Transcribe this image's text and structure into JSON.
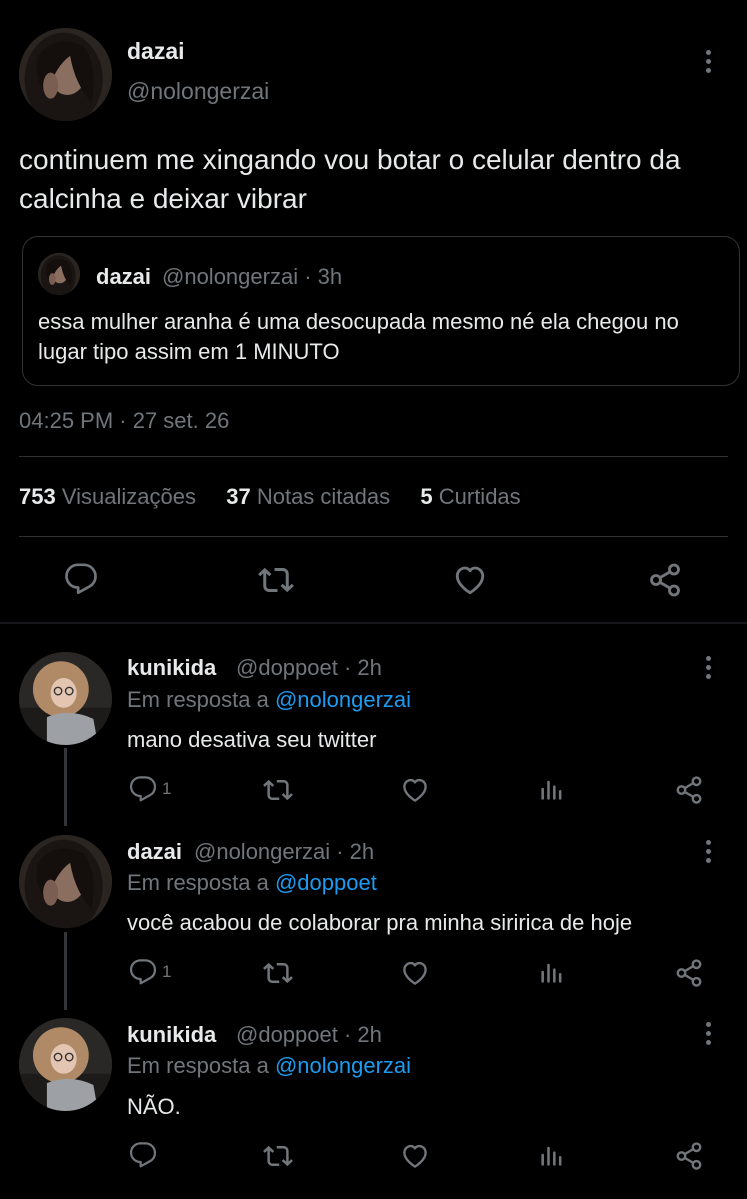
{
  "tweet": {
    "author_name": "dazai",
    "author_handle": "@nolongerzai",
    "text": "continuem me xingando vou botar o celular dentro da calcinha e deixar vibrar",
    "quote": {
      "author_name": "dazai",
      "author_handle_time": "@nolongerzai · 3h",
      "text": "essa mulher aranha é uma desocupada mesmo né ela chegou no lugar tipo assim em 1 MINUTO"
    },
    "timestamp": "04:25 PM · 27 set. 26",
    "stats": {
      "views_count": "753",
      "views_label": "Visualizações",
      "quotes_count": "37",
      "quotes_label": "Notas citadas",
      "likes_count": "5",
      "likes_label": "Curtidas"
    }
  },
  "replies": [
    {
      "author_name": "kunikida",
      "author_handle_time": "@doppoet · 2h",
      "reply_prefix": "Em resposta a",
      "reply_to": "@nolongerzai",
      "text": "mano desativa seu twitter",
      "reply_count": "1"
    },
    {
      "author_name": "dazai",
      "author_handle_time": "@nolongerzai · 2h",
      "reply_prefix": "Em resposta a",
      "reply_to": "@doppoet",
      "text": "você acabou de colaborar pra minha siririca de hoje",
      "reply_count": "1"
    },
    {
      "author_name": "kunikida",
      "author_handle_time": "@doppoet · 2h",
      "reply_prefix": "Em resposta a",
      "reply_to": "@nolongerzai",
      "text": "NÃO.",
      "reply_count": ""
    }
  ],
  "colors": {
    "background": "#000000",
    "text": "#e7e9ea",
    "muted": "#71767b",
    "link": "#1d9bf0",
    "border": "#2f3336"
  },
  "icons": [
    "more-icon",
    "reply-icon",
    "retweet-icon",
    "like-icon",
    "share-icon",
    "analytics-icon"
  ]
}
